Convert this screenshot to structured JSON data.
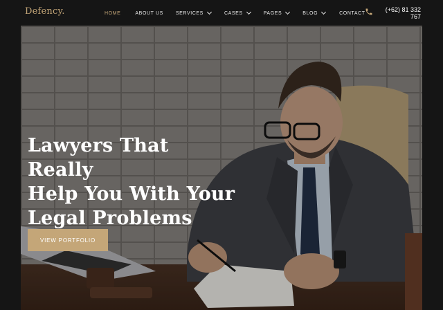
{
  "brand": {
    "name": "Defency",
    "dot": "."
  },
  "nav": {
    "items": [
      {
        "label": "HOME",
        "active": true,
        "dropdown": false
      },
      {
        "label": "ABOUT US",
        "active": false,
        "dropdown": false
      },
      {
        "label": "SERVICES",
        "active": false,
        "dropdown": true
      },
      {
        "label": "CASES",
        "active": false,
        "dropdown": true
      },
      {
        "label": "PAGES",
        "active": false,
        "dropdown": true
      },
      {
        "label": "BLOG",
        "active": false,
        "dropdown": true
      },
      {
        "label": "CONTACT",
        "active": false,
        "dropdown": false
      }
    ]
  },
  "contact": {
    "phone": "(+62) 81 332 767",
    "icon": "phone-icon"
  },
  "hero": {
    "headline_line1": "Lawyers That Really",
    "headline_line2": "Help You With Your",
    "headline_line3": "Legal Problems",
    "cta_label": "VIEW PORTFOLIO"
  },
  "colors": {
    "accent": "#c4a678",
    "background": "#151515",
    "text": "#ffffff"
  }
}
